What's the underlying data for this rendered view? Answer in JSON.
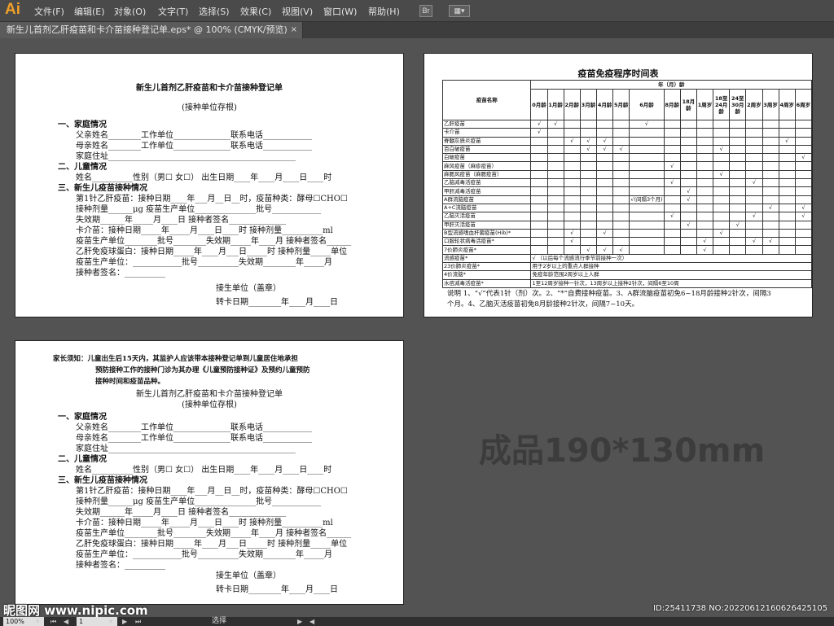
{
  "app": {
    "logo": "Ai",
    "menus": [
      "文件(F)",
      "编辑(E)",
      "对象(O)",
      "文字(T)",
      "选择(S)",
      "效果(C)",
      "视图(V)",
      "窗口(W)",
      "帮助(H)"
    ],
    "bridge": "Br"
  },
  "tab": {
    "title": "新生儿首剂乙肝疫苗和卡介苗接种登记单.eps* @ 100% (CMYK/预览)",
    "close": "×"
  },
  "form1": {
    "title": "新生儿首剂乙肝疫苗和卡介苗接种登记单",
    "subtitle": "(接种单位存根)",
    "lines": [
      "一、家庭情况",
      "父亲姓名________工作单位______________联系电话____________",
      "母亲姓名________工作单位______________联系电话____________",
      "家庭住址______________________________________________",
      "二、儿童情况",
      "姓名__________性别（男☐  女☐）  出生日期____年____月____日____时",
      "三、新生儿疫苗接种情况",
      "第1针乙肝疫苗：接种日期____年___月__日__时，疫苗种类：酵母☐CHO☐",
      "接种剂量______μg    疫苗生产单位_______________批号____________",
      "失效期______年_____月____日               接种者签名______________",
      "卡介苗：接种日期_____年_____月____日____时  接种剂量__________ml",
      "疫苗生产单位________批号________失效期_____年____月  接种者签名______",
      "乙肝免疫球蛋白：接种日期_____年____月___日_____时  接种剂量_____单位",
      "疫苗生产单位：____________批号__________失效期________年_____月",
      "接种者签名：__________"
    ],
    "unit": "接生单位（盖章）",
    "date": "转卡日期________年____月____日"
  },
  "form2": {
    "notice": [
      "家长须知：儿童出生后15天内，其监护人应该带本接种登记单到儿童居住地承担",
      "预防接种工作的接种门诊为其办理《儿童预防接种证》及预约儿童预防",
      "接种时间和疫苗品种。"
    ],
    "title": "新生儿首剂乙肝疫苗和卡介苗接种登记单",
    "subtitle": "(接种单位存根)",
    "lines": [
      "一、家庭情况",
      "父亲姓名________工作单位______________联系电话____________",
      "母亲姓名________工作单位______________联系电话____________",
      "家庭住址______________________________________________",
      "二、儿童情况",
      "姓名__________性别（男☐  女☐）  出生日期____年____月____日____时",
      "三、新生儿疫苗接种情况",
      "第1针乙肝疫苗：接种日期____年___月__日__时，疫苗种类：酵母☐CHO☐",
      "接种剂量______μg    疫苗生产单位_______________批号____________",
      "失效期______年_____月____日               接种者签名______________",
      "卡介苗：接种日期_____年_____月____日____时  接种剂量__________ml",
      "疫苗生产单位________批号________失效期_____年____月  接种者签名______",
      "乙肝免疫球蛋白：接种日期_____年____月___日_____时  接种剂量_____单位",
      "疫苗生产单位：____________批号__________失效期________年_____月",
      "接种者签名：__________"
    ],
    "unit": "接生单位（盖章）",
    "date": "转卡日期________年____月____日"
  },
  "schedule": {
    "title": "疫苗免疫程序时间表",
    "age_group": "年（月）龄",
    "name_header": "疫苗名称",
    "ages": [
      "0月龄",
      "1月龄",
      "2月龄",
      "3月龄",
      "4月龄",
      "5月龄",
      "6月龄",
      "8月龄",
      "18月龄",
      "1周岁",
      "18至24月龄",
      "24至30月龄",
      "2周岁",
      "3周岁",
      "4周岁",
      "6周岁"
    ],
    "rows": [
      {
        "name": "乙肝疫苗",
        "marks": [
          "√",
          "√",
          "",
          "",
          "",
          "",
          "√",
          "",
          "",
          "",
          "",
          "",
          "",
          "",
          "",
          ""
        ]
      },
      {
        "name": "卡介苗",
        "marks": [
          "√",
          "",
          "",
          "",
          "",
          "",
          "",
          "",
          "",
          "",
          "",
          "",
          "",
          "",
          "",
          ""
        ]
      },
      {
        "name": "脊髓灰质炎疫苗",
        "marks": [
          "",
          "",
          "√",
          "√",
          "√",
          "",
          "",
          "",
          "",
          "",
          "",
          "",
          "",
          "",
          "√",
          ""
        ]
      },
      {
        "name": "百白破疫苗",
        "marks": [
          "",
          "",
          "",
          "√",
          "√",
          "√",
          "",
          "",
          "",
          "",
          "√",
          "",
          "",
          "",
          "",
          ""
        ]
      },
      {
        "name": "白破疫苗",
        "marks": [
          "",
          "",
          "",
          "",
          "",
          "",
          "",
          "",
          "",
          "",
          "",
          "",
          "",
          "",
          "",
          "√"
        ]
      },
      {
        "name": "麻风疫苗（麻疹疫苗）",
        "marks": [
          "",
          "",
          "",
          "",
          "",
          "",
          "",
          "√",
          "",
          "",
          "",
          "",
          "",
          "",
          "",
          ""
        ]
      },
      {
        "name": "麻腮风疫苗（麻腮疫苗）",
        "marks": [
          "",
          "",
          "",
          "",
          "",
          "",
          "",
          "",
          "",
          "",
          "√",
          "",
          "",
          "",
          "",
          ""
        ]
      },
      {
        "name": "乙脑减毒活疫苗",
        "marks": [
          "",
          "",
          "",
          "",
          "",
          "",
          "",
          "√",
          "",
          "",
          "",
          "",
          "√",
          "",
          "",
          ""
        ]
      },
      {
        "name": "甲肝减毒活疫苗",
        "marks": [
          "",
          "",
          "",
          "",
          "",
          "",
          "",
          "",
          "√",
          "",
          "",
          "",
          "",
          "",
          "",
          ""
        ]
      },
      {
        "name": "A群流脑疫苗",
        "marks": [
          "",
          "",
          "",
          "",
          "",
          "",
          "√(间隔3个月)",
          "",
          "√",
          "",
          "",
          "",
          "",
          "",
          "",
          ""
        ]
      },
      {
        "name": "A+C流脑疫苗",
        "marks": [
          "",
          "",
          "",
          "",
          "",
          "",
          "",
          "",
          "",
          "",
          "",
          "",
          "",
          "√",
          "",
          "√"
        ]
      },
      {
        "name": "乙脑灭活疫苗",
        "marks": [
          "",
          "",
          "",
          "",
          "",
          "",
          "",
          "√",
          "",
          "",
          "",
          "",
          "√",
          "",
          "",
          "√"
        ]
      },
      {
        "name": "甲肝灭活疫苗",
        "marks": [
          "",
          "",
          "",
          "",
          "",
          "",
          "",
          "",
          "√",
          "",
          "",
          "√",
          "",
          "",
          "",
          ""
        ]
      },
      {
        "name": "B型流感嗜血杆菌疫苗(Hib)*",
        "marks": [
          "",
          "",
          "√",
          "",
          "√",
          "",
          "",
          "",
          "",
          "",
          "√",
          "",
          "",
          "",
          "",
          ""
        ]
      },
      {
        "name": "口服轮状病毒活疫苗*",
        "marks": [
          "",
          "",
          "√",
          "",
          "",
          "",
          "",
          "",
          "",
          "√",
          "",
          "",
          "√",
          "√",
          "",
          ""
        ]
      },
      {
        "name": "7价肺炎疫苗*",
        "marks": [
          "",
          "",
          "",
          "√",
          "√",
          "√",
          "",
          "",
          "",
          "√",
          "",
          "",
          "",
          "",
          "",
          ""
        ]
      }
    ],
    "text_rows": [
      {
        "name": "流感疫苗*",
        "text": "√  （以后每个流感流行季节前接种一次）"
      },
      {
        "name": "23价肺炎疫苗*",
        "text": "用于2岁以上的重点人群接种"
      },
      {
        "name": "4价流脑*",
        "text": "免疫年龄范围2周岁以上人群"
      },
      {
        "name": "水痘减毒活疫苗*",
        "text": "1至12周岁接种一针次，13周岁以上接种2针次，间隔6至10周"
      }
    ],
    "note": [
      "说明 1、“√”代表1针（剂）次。2、“*”自费接种疫苗。3、A群流脑疫苗初免6~18月龄接种2针次，间隔3",
      "个月。4、乙脑灭活疫苗初免8月龄接种2针次，间隔7~10天。"
    ]
  },
  "finished_size": "成品190*130mm",
  "status": {
    "zoom": "100%",
    "page": "1",
    "mode": "选择"
  },
  "watermark": {
    "site": "昵图网 www.nipic.com",
    "id": "ID:25411738 NO:20220612160626425105"
  }
}
